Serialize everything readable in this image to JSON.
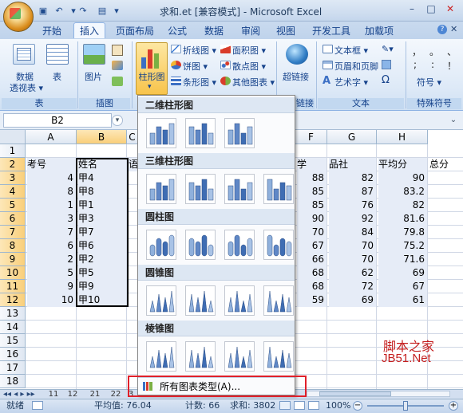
{
  "window": {
    "title": "求和.et [兼容模式] - Microsoft Excel"
  },
  "tabs": [
    "开始",
    "插入",
    "页面布局",
    "公式",
    "数据",
    "审阅",
    "视图",
    "开发工具",
    "加载项"
  ],
  "ribbon": {
    "pivot_label_1": "数据",
    "pivot_label_2": "透视表 ▾",
    "table_label": "表",
    "picture_label": "图片",
    "chart_label": "柱形图",
    "line_label": "折线图 ▾",
    "pie_label": "饼图 ▾",
    "barchart_label": "条形图 ▾",
    "area_label": "面积图 ▾",
    "scatter_label": "散点图 ▾",
    "other_label": "其他图表 ▾",
    "hyperlink_label": "超链接",
    "textbox_label": "文本框 ▾",
    "header_label": "页眉和页脚",
    "wordart_label": "艺术字 ▾",
    "symbol_label": "符号 ▾",
    "group_table": "表",
    "group_illus": "插图",
    "group_link": "链接",
    "group_text": "文本",
    "group_special": "特殊符号",
    "special_chars": [
      "，",
      "。",
      "、",
      ";",
      ":",
      "！"
    ],
    "omega": "Ω"
  },
  "formula_bar": {
    "name_box": "B2"
  },
  "columns": [
    "A",
    "B",
    "C",
    "F",
    "G",
    "H"
  ],
  "rows": [
    "1",
    "2",
    "3",
    "4",
    "5",
    "6",
    "7",
    "8",
    "9",
    "10",
    "11",
    "12",
    "13",
    "14",
    "15",
    "16",
    "17",
    "18"
  ],
  "header_row": {
    "a": "考号",
    "b": "姓名",
    "c": "语",
    "f": "学",
    "g": "品社",
    "h": "平均分",
    "i": "总分"
  },
  "data_rows": [
    {
      "a": "4",
      "b": "甲4",
      "f": "88",
      "g": "82",
      "h": "90"
    },
    {
      "a": "8",
      "b": "甲8",
      "f": "85",
      "g": "87",
      "h": "83.2"
    },
    {
      "a": "1",
      "b": "甲1",
      "f": "85",
      "g": "76",
      "h": "82"
    },
    {
      "a": "3",
      "b": "甲3",
      "f": "90",
      "g": "92",
      "h": "81.6"
    },
    {
      "a": "7",
      "b": "甲7",
      "f": "70",
      "g": "84",
      "h": "79.8"
    },
    {
      "a": "6",
      "b": "甲6",
      "f": "67",
      "g": "70",
      "h": "75.2"
    },
    {
      "a": "2",
      "b": "甲2",
      "f": "66",
      "g": "70",
      "h": "71.6"
    },
    {
      "a": "5",
      "b": "甲5",
      "f": "68",
      "g": "62",
      "h": "69"
    },
    {
      "a": "9",
      "b": "甲9",
      "f": "68",
      "g": "72",
      "h": "67"
    },
    {
      "a": "10",
      "b": "甲10",
      "f": "59",
      "g": "69",
      "h": "61"
    }
  ],
  "dropdown": {
    "sections": [
      "二维柱形图",
      "三维柱形图",
      "圆柱图",
      "圆锥图",
      "棱锥图"
    ],
    "all_chart_types": "所有图表类型(A)..."
  },
  "sheet_tabs": [
    "11",
    "12",
    "21",
    "22",
    "3"
  ],
  "status": {
    "ready": "就绪",
    "average": "平均值: 76.04",
    "count": "计数: 66",
    "sum": "求和: 3802",
    "zoom": "100%"
  },
  "watermark": {
    "line1": "脚本之家",
    "line2": "JB51.Net"
  },
  "colors": {
    "accent": "#15428b",
    "ribbon_bg": "#dde9f7",
    "highlight": "#f8c44c",
    "red_box": "#e0202a"
  }
}
